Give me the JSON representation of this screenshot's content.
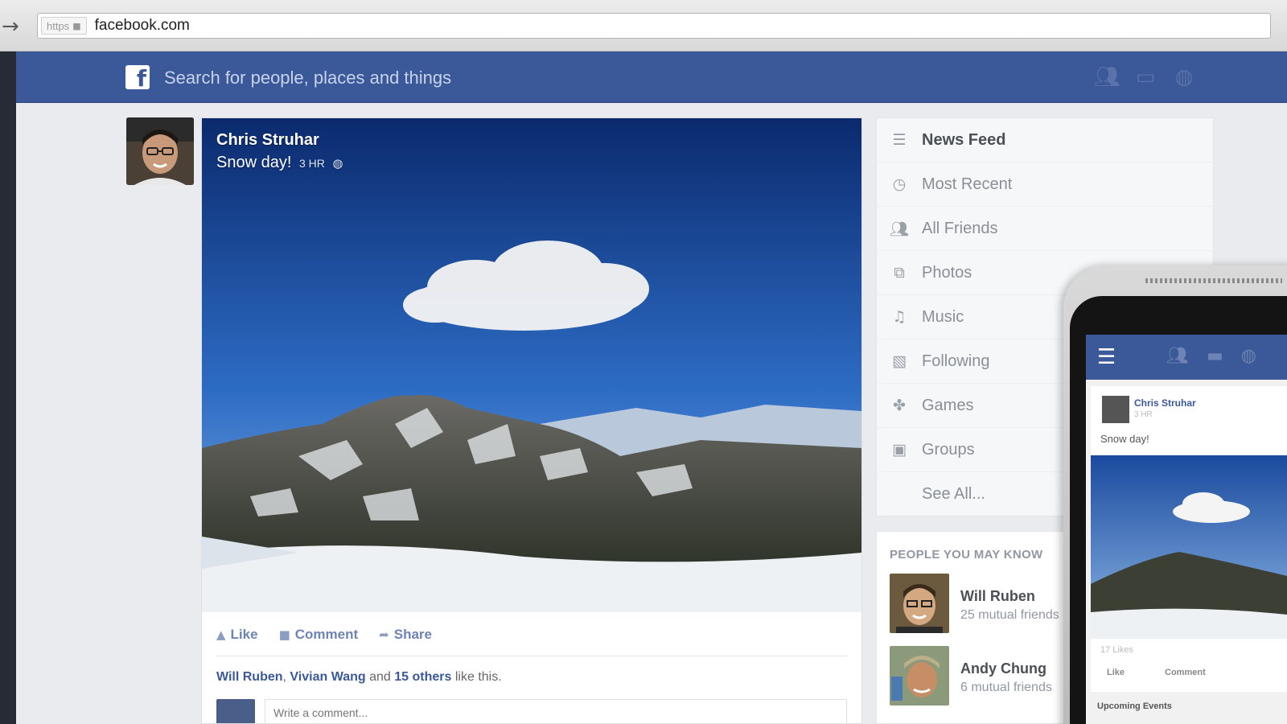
{
  "browser": {
    "back_icon": "back-arrow-icon",
    "https_label": "https",
    "url": "facebook.com"
  },
  "header": {
    "logo_text": "f",
    "search_placeholder": "Search for people, places and things",
    "icons": [
      "friends-icon",
      "messages-icon",
      "notifications-globe-icon"
    ]
  },
  "post": {
    "author": "Chris Struhar",
    "status": "Snow day!",
    "time": "3 HR",
    "actions": [
      {
        "label": "Like",
        "icon": "thumbs-up-icon"
      },
      {
        "label": "Comment",
        "icon": "comment-icon"
      },
      {
        "label": "Share",
        "icon": "share-icon"
      }
    ],
    "likes": {
      "name1": "Will Ruben",
      "sep": ",",
      "name2": "Vivian Wang",
      "and": "and",
      "others": "15 others",
      "suffix": "like this."
    },
    "comment_placeholder": "Write a comment..."
  },
  "nav": {
    "items": [
      {
        "label": "News Feed",
        "icon": "news-feed-icon"
      },
      {
        "label": "Most Recent",
        "icon": "clock-icon"
      },
      {
        "label": "All Friends",
        "icon": "friends-icon"
      },
      {
        "label": "Photos",
        "icon": "photos-icon"
      },
      {
        "label": "Music",
        "icon": "music-note-icon"
      },
      {
        "label": "Following",
        "icon": "following-icon"
      },
      {
        "label": "Games",
        "icon": "games-icon"
      },
      {
        "label": "Groups",
        "icon": "groups-icon"
      },
      {
        "label": "See All...",
        "icon": ""
      }
    ]
  },
  "pymk": {
    "title": "PEOPLE YOU MAY KNOW",
    "people": [
      {
        "name": "Will Ruben",
        "mutual": "25 mutual friends"
      },
      {
        "name": "Andy Chung",
        "mutual": "6 mutual friends"
      }
    ]
  },
  "phone": {
    "author": "Chris Struhar",
    "time": "3 HR",
    "status": "Snow day!",
    "likes": "17 Likes",
    "like_label": "Like",
    "comment_label": "Comment",
    "upcoming": "Upcoming Events"
  }
}
